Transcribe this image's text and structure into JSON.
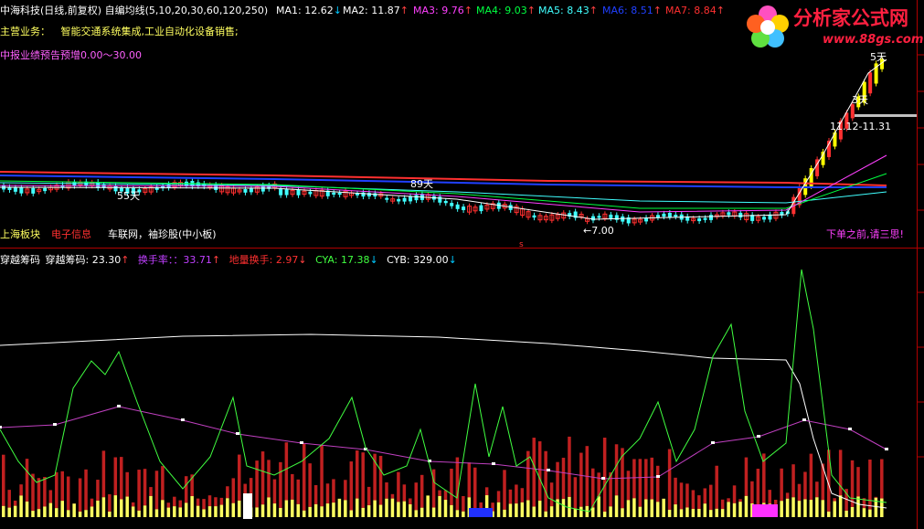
{
  "header": {
    "title": "中海科技(日线,前复权)",
    "ma_title": "自编均线(5,10,20,30,60,120,250)",
    "ma": [
      {
        "label": "MA1: 12.62",
        "color": "#ffffff",
        "arrow": "↓",
        "arrow_color": "#00c8ff"
      },
      {
        "label": "MA2: 11.87",
        "color": "#ffffff",
        "arrow": "↑",
        "arrow_color": "#ff4040"
      },
      {
        "label": "MA3: 9.76",
        "color": "#ff40ff",
        "arrow": "↑",
        "arrow_color": "#ff4040"
      },
      {
        "label": "MA4: 9.03",
        "color": "#00ff40",
        "arrow": "↑",
        "arrow_color": "#ff4040"
      },
      {
        "label": "MA5: 8.43",
        "color": "#40ffff",
        "arrow": "↑",
        "arrow_color": "#ff4040"
      },
      {
        "label": "MA6: 8.51",
        "color": "#2040ff",
        "arrow": "↑",
        "arrow_color": "#ff4040"
      },
      {
        "label": "MA7: 8.84",
        "color": "#ff3030",
        "arrow": "↑",
        "arrow_color": "#ff4040"
      }
    ]
  },
  "info": {
    "business_label": "主营业务：",
    "business_text": "智能交通系统集成,工业自动化设备销售;",
    "forecast": "中报业绩预告预增0.00～30.00"
  },
  "annotations": {
    "days55": "55天",
    "days89": "89天",
    "low_price": "←7.00",
    "days3": "3天",
    "days5": "5天",
    "range": "11.12-11.31",
    "sector_sh": "上海板块",
    "sector_elec": "电子信息",
    "sector_concept": "车联网，袖珍股(中小板)",
    "warning": "下单之前,请三思!",
    "marker_s": "s"
  },
  "indicator": {
    "name": "穿越筹码",
    "value_label": "穿越筹码: 23.30",
    "value_arrow": "↑",
    "turnover": "换手率：：33.71",
    "turnover_arrow": "↑",
    "floor_turnover": "地量换手: 2.97",
    "floor_arrow": "↓",
    "cya": "CYA: 17.38",
    "cya_arrow": "↓",
    "cyb": "CYB: 329.00",
    "cyb_arrow": "↓"
  },
  "logo": {
    "text": "分析家公式网",
    "url": "www.88gs.com"
  },
  "colors": {
    "up": "#ff3030",
    "down": "#40ffff",
    "yellow": "#ffff00",
    "green_line": "#40ff40",
    "purple_line": "#c040c0",
    "white_line": "#ffffff"
  }
}
